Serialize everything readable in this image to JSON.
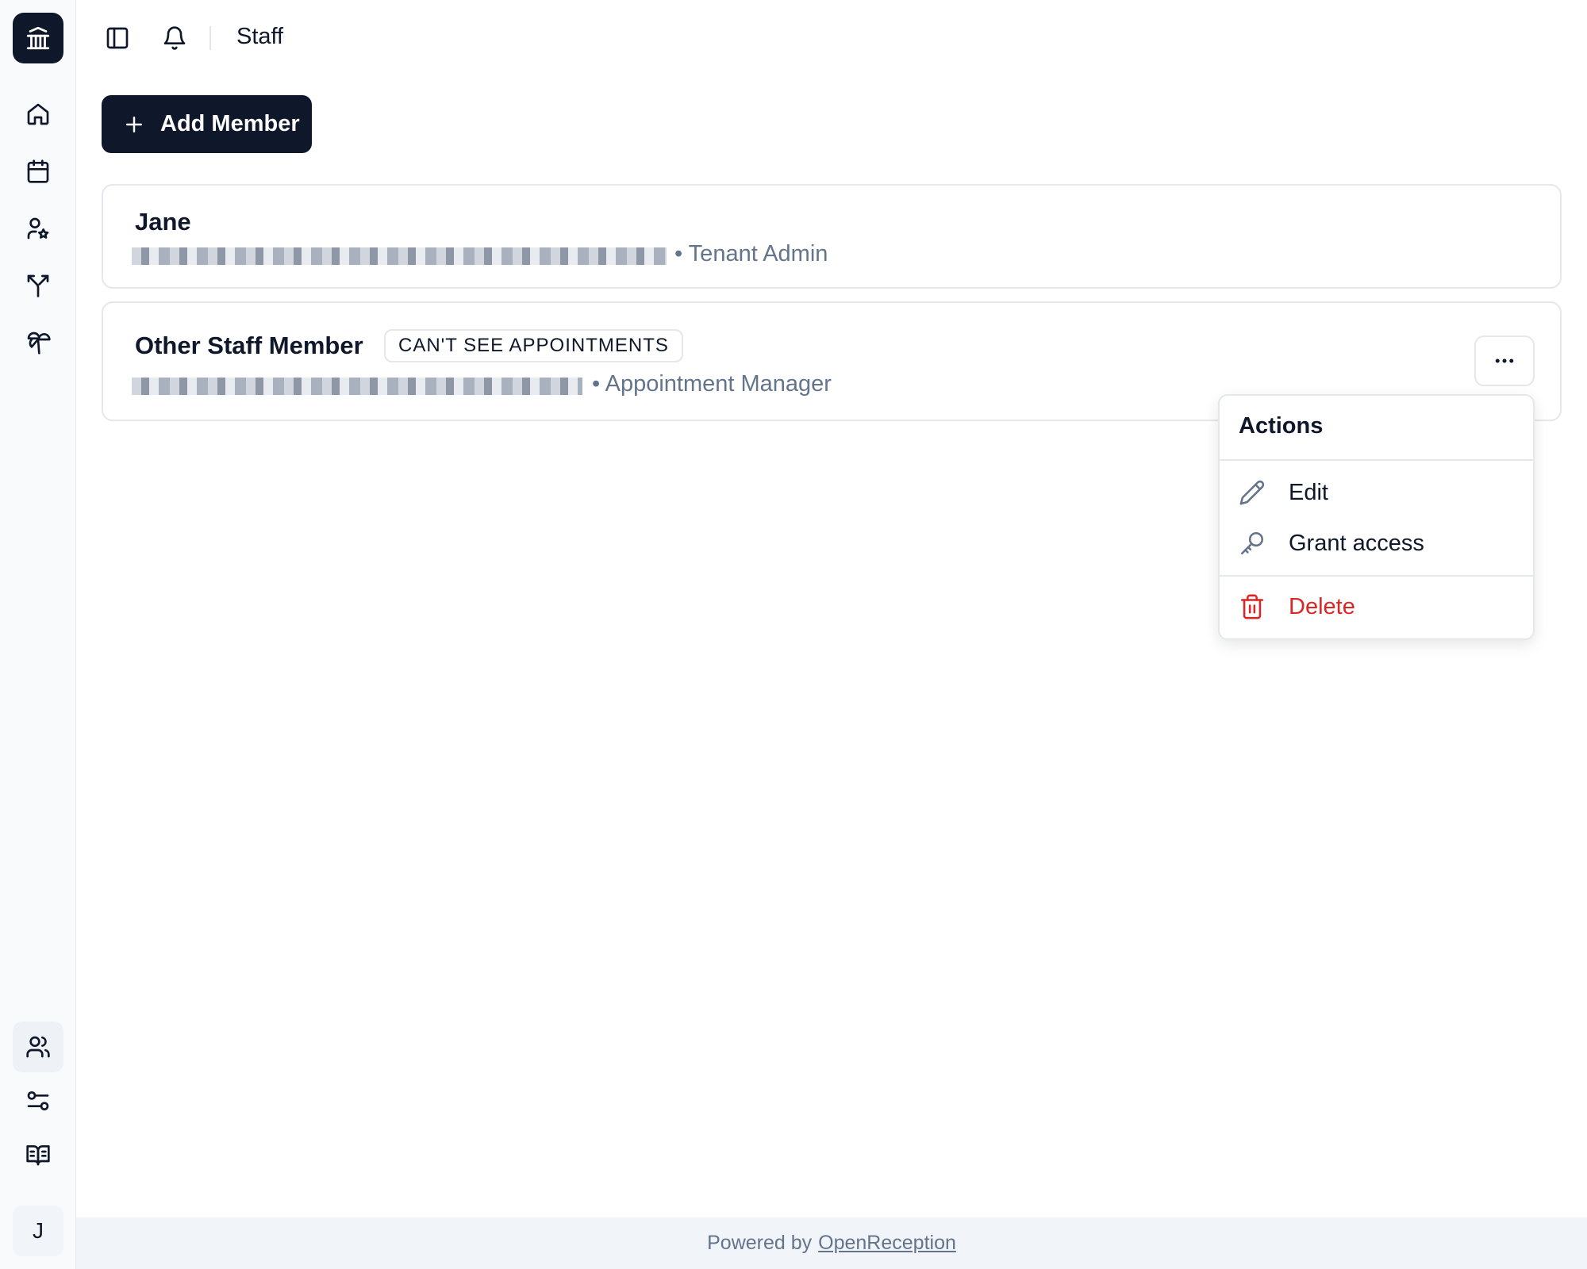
{
  "header": {
    "title": "Staff"
  },
  "toolbar": {
    "add_member_label": "Add Member"
  },
  "staff": [
    {
      "name": "Jane",
      "role": "• Tenant Admin"
    },
    {
      "name": "Other Staff Member",
      "badge": "CAN'T SEE APPOINTMENTS",
      "role": "• Appointment Manager"
    }
  ],
  "menu": {
    "title": "Actions",
    "items": [
      {
        "label": "Edit",
        "icon": "pencil-icon"
      },
      {
        "label": "Grant access",
        "icon": "key-icon"
      },
      {
        "label": "Delete",
        "icon": "trash-icon"
      }
    ]
  },
  "sidebar": {
    "avatar_initial": "J",
    "icons": [
      "bank-icon",
      "home-icon",
      "calendar-icon",
      "user-star-icon",
      "split-icon",
      "palm-tree-icon",
      "users-icon",
      "settings-sliders-icon",
      "book-open-icon"
    ]
  },
  "footer": {
    "prefix": "Powered by",
    "link": "OpenReception"
  },
  "colors": {
    "primary": "#0f172a",
    "danger": "#dc2626",
    "muted": "#64748b",
    "sidebar_bg": "#f8fafc"
  }
}
